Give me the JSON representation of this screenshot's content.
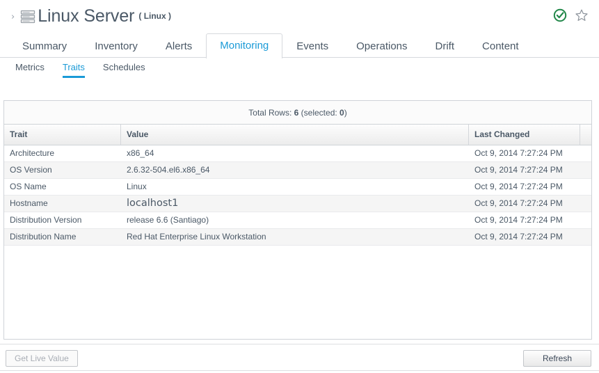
{
  "header": {
    "breadcrumb_chevron": "›",
    "resource_icon": "server-stack-icon",
    "title": "Linux Server",
    "type_label": "( Linux )",
    "availability_icon": "availability-up-check-icon",
    "favorite_icon": "star-outline-icon"
  },
  "primary_tabs": [
    {
      "label": "Summary",
      "active": false
    },
    {
      "label": "Inventory",
      "active": false
    },
    {
      "label": "Alerts",
      "active": false
    },
    {
      "label": "Monitoring",
      "active": true
    },
    {
      "label": "Events",
      "active": false
    },
    {
      "label": "Operations",
      "active": false
    },
    {
      "label": "Drift",
      "active": false
    },
    {
      "label": "Content",
      "active": false
    }
  ],
  "secondary_tabs": [
    {
      "label": "Metrics",
      "active": false
    },
    {
      "label": "Traits",
      "active": true
    },
    {
      "label": "Schedules",
      "active": false
    }
  ],
  "table": {
    "summary_prefix": "Total Rows:",
    "total_rows": "6",
    "selected_prefix": "(selected:",
    "selected_count": "0",
    "selected_suffix": ")",
    "columns": [
      "Trait",
      "Value",
      "Last Changed"
    ],
    "rows": [
      {
        "trait": "Architecture",
        "value": "x86_64",
        "changed": "Oct 9, 2014 7:27:24 PM"
      },
      {
        "trait": "OS Version",
        "value": "2.6.32-504.el6.x86_64",
        "changed": "Oct 9, 2014 7:27:24 PM"
      },
      {
        "trait": "OS Name",
        "value": "Linux",
        "changed": "Oct 9, 2014 7:27:24 PM"
      },
      {
        "trait": "Hostname",
        "value": "localhost1",
        "changed": "Oct 9, 2014 7:27:24 PM"
      },
      {
        "trait": "Distribution Version",
        "value": "release 6.6 (Santiago)",
        "changed": "Oct 9, 2014 7:27:24 PM"
      },
      {
        "trait": "Distribution Name",
        "value": "Red Hat Enterprise Linux Workstation",
        "changed": "Oct 9, 2014 7:27:24 PM"
      }
    ]
  },
  "footer": {
    "get_live_value_label": "Get Live Value",
    "refresh_label": "Refresh"
  },
  "colors": {
    "accent": "#1a9ad7",
    "text": "#4a5866",
    "availability_green": "#218749",
    "row_alt": "#f5f5f5",
    "border": "#cfd3d8"
  }
}
